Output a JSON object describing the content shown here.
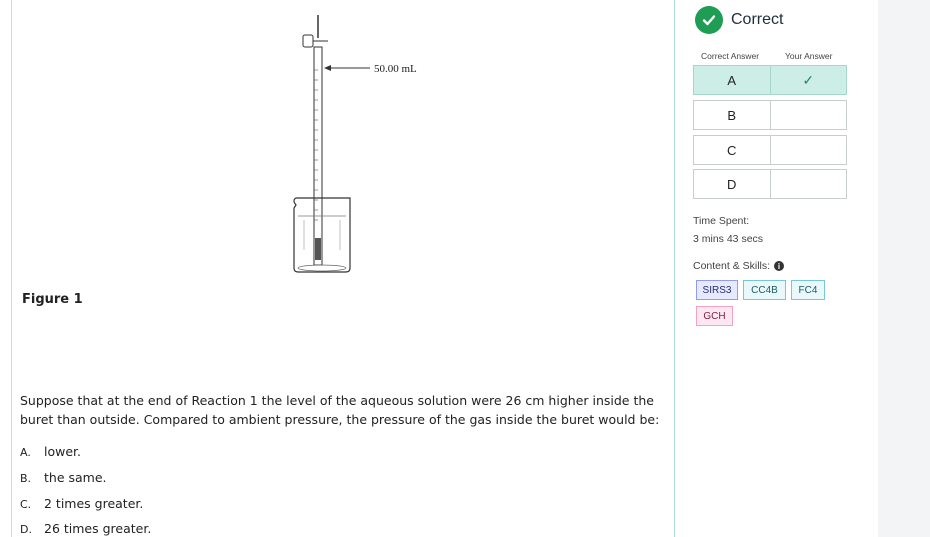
{
  "figure": {
    "buret_label": "50.00 mL",
    "caption": "Figure 1"
  },
  "question": {
    "text": "Suppose that at the end of Reaction 1 the level of the aqueous solution were 26 cm higher inside the buret than outside. Compared to ambient pressure, the pressure of the gas inside the buret would be:"
  },
  "choices": [
    {
      "letter": "A.",
      "text": "lower."
    },
    {
      "letter": "B.",
      "text": "the same."
    },
    {
      "letter": "C.",
      "text": "2 times greater."
    },
    {
      "letter": "D.",
      "text": "26 times greater."
    }
  ],
  "result": {
    "status": "Correct",
    "status_color": "#1f9d55",
    "correct_answer_header": "Correct Answer",
    "your_answer_header": "Your Answer",
    "rows": [
      {
        "option": "A",
        "your_mark": "✓",
        "is_correct": true
      },
      {
        "option": "B",
        "your_mark": "",
        "is_correct": false
      },
      {
        "option": "C",
        "your_mark": "",
        "is_correct": false
      },
      {
        "option": "D",
        "your_mark": "",
        "is_correct": false
      }
    ]
  },
  "time": {
    "label": "Time Spent:",
    "value": "3 mins 43 secs"
  },
  "skills": {
    "label": "Content & Skills:",
    "tags": [
      "SIRS3",
      "CC4B",
      "FC4",
      "GCH"
    ]
  }
}
